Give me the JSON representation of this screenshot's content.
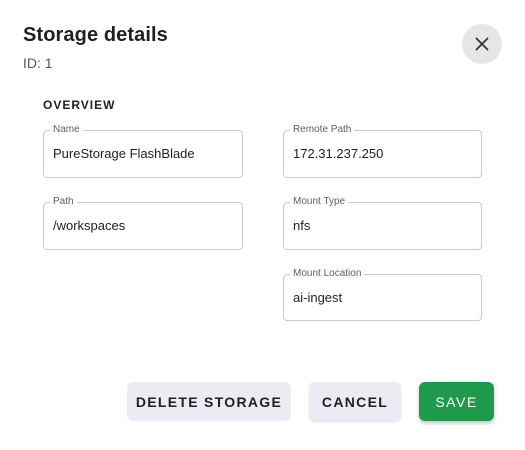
{
  "dialog": {
    "title": "Storage details",
    "subtitle": "ID: 1",
    "close_icon": "close-icon"
  },
  "overview": {
    "section_title": "OVERVIEW",
    "name": {
      "label": "Name",
      "value": "PureStorage FlashBlade"
    },
    "path": {
      "label": "Path",
      "value": "/workspaces"
    },
    "remote_path": {
      "label": "Remote Path",
      "value": "172.31.237.250"
    },
    "mount_type": {
      "label": "Mount Type",
      "value": "nfs"
    },
    "mount_location": {
      "label": "Mount Location",
      "value": "ai-ingest"
    }
  },
  "actions": {
    "delete_label": "DELETE STORAGE",
    "cancel_label": "CANCEL",
    "save_label": "SAVE"
  },
  "colors": {
    "save_background": "#1f9a4c",
    "secondary_button_background": "#ebebf3",
    "close_button_background": "#e6e6e6",
    "field_border": "#c9c9c9"
  }
}
